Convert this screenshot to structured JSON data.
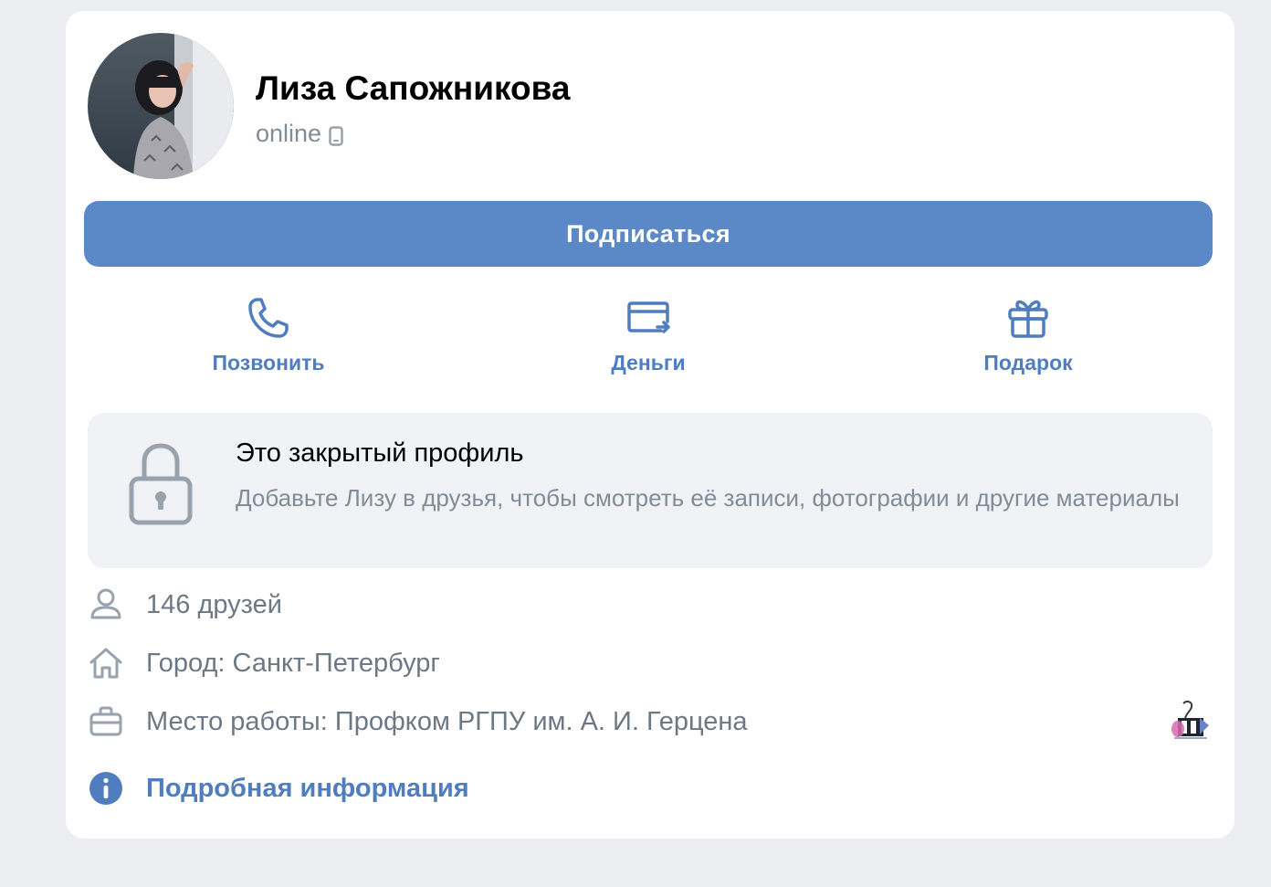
{
  "profile": {
    "name": "Лиза Сапожникова",
    "status": "online",
    "status_device_icon": "mobile-phone-icon"
  },
  "subscribe_button": {
    "label": "Подписаться",
    "color": "#5b88c6"
  },
  "actions": [
    {
      "label": "Позвонить",
      "icon": "phone-icon"
    },
    {
      "label": "Деньги",
      "icon": "money-transfer-icon"
    },
    {
      "label": "Подарок",
      "icon": "gift-icon"
    }
  ],
  "private_notice": {
    "icon": "lock-icon",
    "title": "Это закрытый профиль",
    "description": "Добавьте Лизу в друзья, чтобы смотреть её записи, фотографии и другие материалы"
  },
  "info": {
    "friends": {
      "icon": "user-icon",
      "text": "146 друзей"
    },
    "city": {
      "icon": "home-icon",
      "text": "Город: Санкт-Петербург"
    },
    "work": {
      "icon": "briefcase-icon",
      "text": "Место работы: Профком РГПУ им. А. И. Герцена"
    },
    "more": {
      "icon": "info-icon",
      "text": "Подробная информация"
    }
  },
  "colors": {
    "accent": "#4f7dbd",
    "secondary_text": "#818c99",
    "background": "#ebedf0"
  }
}
